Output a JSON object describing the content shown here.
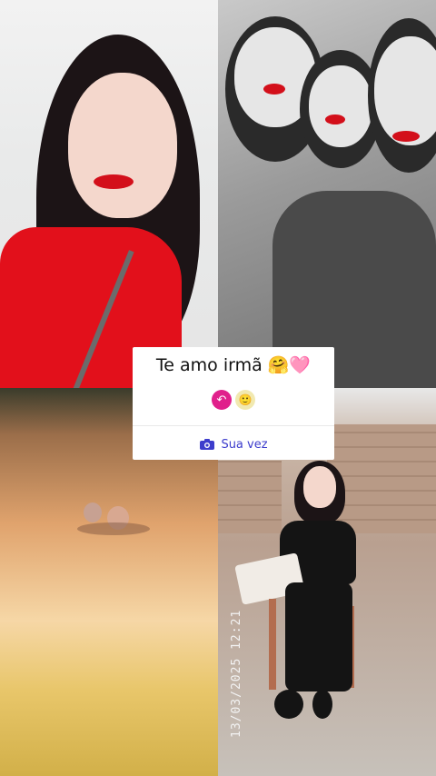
{
  "reply_card": {
    "message": "Te amo irmã 🤗🩷",
    "reply_icon": "reply-arrow-icon",
    "reaction_emoji": "🙂",
    "your_turn_label": "Sua vez",
    "camera_icon": "camera-icon",
    "accent": "#3d3dcc",
    "reply_color": "#e0208b"
  },
  "photo_timestamp": "13/03/2025 12:21"
}
